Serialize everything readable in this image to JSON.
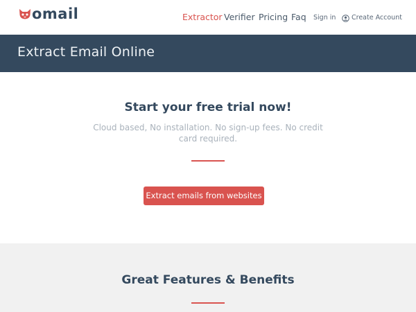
{
  "brand": {
    "logo_text": "omail",
    "accent_color": "#d9534f",
    "dark_color": "#34495e",
    "icon": "cat-face-icon"
  },
  "nav": {
    "extractor": "Extractor",
    "verifier": "Verifier",
    "pricing": "Pricing",
    "faq": "Faq",
    "sign_in": "Sign in",
    "create_account": "Create Account",
    "create_account_icon": "user-circle-icon",
    "active": "Extractor"
  },
  "banner": {
    "title": "Extract Email Online"
  },
  "hero": {
    "title": "Start your free trial now!",
    "subtitle": "Cloud based, No installation. No sign-up fees. No credit card required.",
    "cta_label": "Extract emails from websites"
  },
  "features": {
    "title": "Great Features & Benefits",
    "background": "#f1f1f1"
  }
}
